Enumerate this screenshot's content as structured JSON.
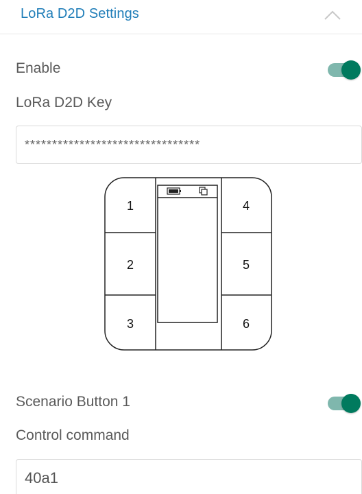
{
  "header": {
    "title": "LoRa D2D Settings",
    "collapse_icon": "chevron-up-icon"
  },
  "enable": {
    "label": "Enable",
    "toggle_on": true
  },
  "key": {
    "label": "LoRa D2D Key",
    "value": "********************************"
  },
  "device": {
    "buttons": [
      "1",
      "2",
      "3",
      "4",
      "5",
      "6"
    ],
    "screen_icons": [
      "battery-icon",
      "copy-icon"
    ]
  },
  "scenario": {
    "label": "Scenario Button 1",
    "toggle_on": true
  },
  "command": {
    "label": "Control command",
    "value": "40a1"
  },
  "colors": {
    "accent": "#1f7db8",
    "toggle_on": "#007a5e",
    "toggle_track": "#7fb7ad"
  }
}
